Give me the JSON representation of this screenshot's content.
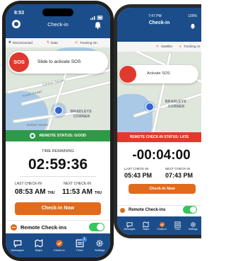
{
  "back": {
    "status_time": "7:47 PM",
    "battery": "100%",
    "title": "Check-in",
    "indicators": [
      "Satellite",
      "Tracking on"
    ],
    "sos_label": "Activate SOS",
    "map_label": [
      "BRADLEYS",
      "CORNER"
    ],
    "status_banner": "REMOTE CHECK-IN STATUS: LATE",
    "countdown": "-00:04:00",
    "last_label": "LAST CHECK-IN",
    "last_value": "05:43 PM",
    "next_label": "NEXT CHECK-IN",
    "next_value": "07:43 PM",
    "check_button": "Check-in Now",
    "remote_label": "Remote Check-ins",
    "tabs": [
      "Messages",
      "Maps",
      "Check-in",
      "Feed",
      "Settings"
    ],
    "colors": {
      "banner": "#e03a2e",
      "toggle": "#34c759"
    }
  },
  "front": {
    "status_time": "8:53",
    "title": "Check-in",
    "indicators": [
      "Disconnected",
      "Data",
      "Tracking On"
    ],
    "sos_circle": "SOS",
    "sos_label": "Slide to activate SOS",
    "streets": [
      "Clinton Street",
      "Front Street",
      "Hobart Street"
    ],
    "map_label": [
      "BRADLEYS",
      "CORNER"
    ],
    "status_banner": "REMOTE STATUS: GOOD",
    "time_remaining_label": "TIME REMAINING",
    "countdown": "02:59:36",
    "last_label": "LAST CHECK-IN",
    "last_value": "08:53 AM",
    "last_day": "THU",
    "next_label": "NEXT CHECK-IN",
    "next_value": "11:53 AM",
    "next_day": "THU",
    "check_button": "Check-in Now",
    "remote_label": "Remote Check-ins",
    "tabs": [
      "Messages",
      "Maps",
      "Check-in",
      "Feed",
      "Settings"
    ],
    "feed_badge": "1",
    "colors": {
      "header": "#1b4d8a",
      "banner": "#2e9a48",
      "button": "#e26a1c",
      "toggle": "#34c759"
    }
  }
}
